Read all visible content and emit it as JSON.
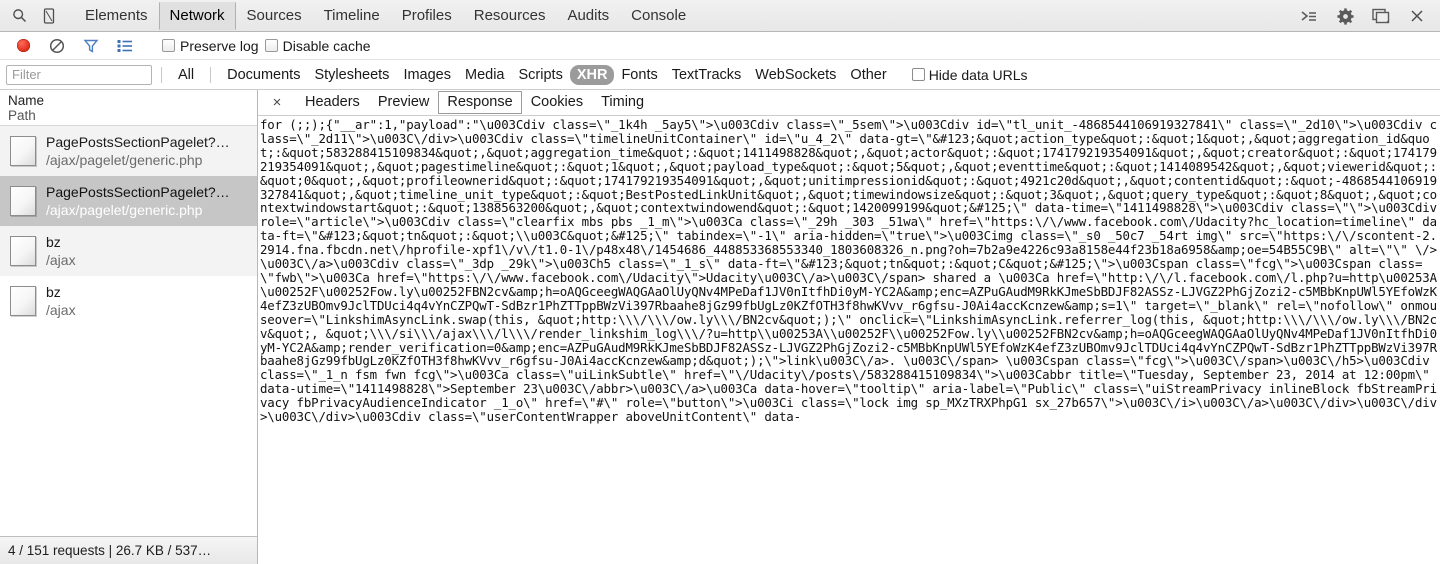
{
  "toolbar": {
    "icons": [
      {
        "name": "search-icon",
        "label": "Search"
      },
      {
        "name": "device-mode-icon",
        "label": "Toggle device mode"
      }
    ],
    "panels": [
      {
        "label": "Elements",
        "selected": false
      },
      {
        "label": "Network",
        "selected": true
      },
      {
        "label": "Sources",
        "selected": false
      },
      {
        "label": "Timeline",
        "selected": false
      },
      {
        "label": "Profiles",
        "selected": false
      },
      {
        "label": "Resources",
        "selected": false
      },
      {
        "label": "Audits",
        "selected": false
      },
      {
        "label": "Console",
        "selected": false
      }
    ],
    "right_icons": [
      {
        "name": "show-drawer-icon",
        "label": "Show console drawer"
      },
      {
        "name": "gear-icon",
        "label": "Settings"
      },
      {
        "name": "dock-side-icon",
        "label": "Dock side"
      },
      {
        "name": "close-icon",
        "label": "Close"
      }
    ]
  },
  "subbar": {
    "record_label": "Record",
    "clear_label": "Clear",
    "filter_label": "Filter",
    "group_label": "Group by frame",
    "preserve_log": {
      "label": "Preserve log",
      "checked": false
    },
    "disable_cache": {
      "label": "Disable cache",
      "checked": false
    }
  },
  "filterbar": {
    "filter_placeholder": "Filter",
    "filter_value": "",
    "types": [
      {
        "label": "All",
        "selected": false
      },
      {
        "label": "Documents",
        "selected": false
      },
      {
        "label": "Stylesheets",
        "selected": false
      },
      {
        "label": "Images",
        "selected": false
      },
      {
        "label": "Media",
        "selected": false
      },
      {
        "label": "Scripts",
        "selected": false
      },
      {
        "label": "XHR",
        "selected": true
      },
      {
        "label": "Fonts",
        "selected": false
      },
      {
        "label": "TextTracks",
        "selected": false
      },
      {
        "label": "WebSockets",
        "selected": false
      },
      {
        "label": "Other",
        "selected": false
      }
    ],
    "hide_data_urls": {
      "label": "Hide data URLs",
      "checked": false
    }
  },
  "requests": {
    "columns": {
      "name": "Name",
      "path": "Path"
    },
    "rows": [
      {
        "name": "PagePostsSectionPagelet?…",
        "path": "/ajax/pagelet/generic.php",
        "selected": false,
        "alt": true
      },
      {
        "name": "PagePostsSectionPagelet?…",
        "path": "/ajax/pagelet/generic.php",
        "selected": true,
        "alt": false
      },
      {
        "name": "bz",
        "path": "/ajax",
        "selected": false,
        "alt": true
      },
      {
        "name": "bz",
        "path": "/ajax",
        "selected": false,
        "alt": false
      }
    ]
  },
  "detail": {
    "close_label": "×",
    "tabs": [
      {
        "label": "Headers",
        "selected": false
      },
      {
        "label": "Preview",
        "selected": false
      },
      {
        "label": "Response",
        "selected": true
      },
      {
        "label": "Cookies",
        "selected": false
      },
      {
        "label": "Timing",
        "selected": false
      }
    ],
    "response_text": "for (;;);{\"__ar\":1,\"payload\":\"\\u003Cdiv class=\\\"_1k4h _5ay5\\\">\\u003Cdiv class=\\\"_5sem\\\">\\u003Cdiv id=\\\"tl_unit_-4868544106919327841\\\" class=\\\"_2d10\\\">\\u003Cdiv class=\\\"_2d11\\\">\\u003C\\/div>\\u003Cdiv class=\\\"timelineUnitContainer\\\" id=\\\"u_4_2\\\" data-gt=\\\"&#123;&quot;action_type&quot;:&quot;1&quot;,&quot;aggregation_id&quot;:&quot;583288415109834&quot;,&quot;aggregation_time&quot;:&quot;1411498828&quot;,&quot;actor&quot;:&quot;174179219354091&quot;,&quot;creator&quot;:&quot;174179219354091&quot;,&quot;pagestimeline&quot;:&quot;1&quot;,&quot;payload_type&quot;:&quot;5&quot;,&quot;eventtime&quot;:&quot;1414089542&quot;,&quot;viewerid&quot;:&quot;0&quot;,&quot;profileownerid&quot;:&quot;174179219354091&quot;,&quot;unitimpressionid&quot;:&quot;4921c20d&quot;,&quot;contentid&quot;:&quot;-4868544106919327841&quot;,&quot;timeline_unit_type&quot;:&quot;BestPostedLinkUnit&quot;,&quot;timewindowsize&quot;:&quot;3&quot;,&quot;query_type&quot;:&quot;8&quot;,&quot;contextwindowstart&quot;:&quot;1388563200&quot;,&quot;contextwindowend&quot;:&quot;1420099199&quot;&#125;\\\" data-time=\\\"1411498828\\\">\\u003Cdiv class=\\\"\\\">\\u003Cdiv role=\\\"article\\\">\\u003Cdiv class=\\\"clearfix mbs pbs _1_m\\\">\\u003Ca class=\\\"_29h _303 _51wa\\\" href=\\\"https:\\/\\/www.facebook.com\\/Udacity?hc_location=timeline\\\" data-ft=\\\"&#123;&quot;tn&quot;:&quot;\\\\u003C&quot;&#125;\\\" tabindex=\\\"-1\\\" aria-hidden=\\\"true\\\">\\u003Cimg class=\\\"_s0 _50c7 _54rt img\\\" src=\\\"https:\\/\\/scontent-2.2914.fna.fbcdn.net\\/hprofile-xpf1\\/v\\/t1.0-1\\/p48x48\\/1454686_448853368553340_1803608326_n.png?oh=7b2a9e4226c93a8158e44f23b18a6958&amp;oe=54B55C9B\\\" alt=\\\"\\\" \\/>\\u003C\\/a>\\u003Cdiv class=\\\"_3dp _29k\\\">\\u003Ch5 class=\\\"_1_s\\\" data-ft=\\\"&#123;&quot;tn&quot;:&quot;C&quot;&#125;\\\">\\u003Cspan class=\\\"fcg\\\">\\u003Cspan class=\\\"fwb\\\">\\u003Ca href=\\\"https:\\/\\/www.facebook.com\\/Udacity\\\">Udacity\\u003C\\/a>\\u003C\\/span> shared a \\u003Ca href=\\\"http:\\/\\/l.facebook.com\\/l.php?u=http\\u00253A\\u00252F\\u00252Fow.ly\\u00252FBN2cv&amp;h=oAQGceegWAQGAaOlUyQNv4MPeDaf1JV0nItfhDi0yM-YC2A&amp;enc=AZPuGAudM9RkKJmeSbBDJF82ASSz-LJVGZ2PhGjZozi2-c5MBbKnpUWl5YEfoWzK4efZ3zUBOmv9JclTDUci4q4vYnCZPQwT-SdBzr1PhZTTppBWzVi397Rbaahe8jGz99fbUgLz0KZfOTH3f8hwKVvv_r6gfsu-J0Ai4accKcnzew&amp;s=1\\\" target=\\\"_blank\\\" rel=\\\"nofollow\\\" onmouseover=\\\"LinkshimAsyncLink.swap(this, &quot;http:\\\\\\/\\\\\\/ow.ly\\\\\\/BN2cv&quot;);\\\" onclick=\\\"LinkshimAsyncLink.referrer_log(this, &quot;http:\\\\\\/\\\\\\/ow.ly\\\\\\/BN2cv&quot;, &quot;\\\\\\/si\\\\\\/ajax\\\\\\/l\\\\\\/render_linkshim_log\\\\\\/?u=http\\\\u00253A\\\\u00252F\\\\u00252Fow.ly\\\\u00252FBN2cv&amp;h=oAQGceegWAQGAaOlUyQNv4MPeDaf1JV0nItfhDi0yM-YC2A&amp;render_verification=0&amp;enc=AZPuGAudM9RkKJmeSbBDJF82ASSz-LJVGZ2PhGjZozi2-c5MBbKnpUWl5YEfoWzK4efZ3zUBOmv9JclTDUci4q4vYnCZPQwT-SdBzr1PhZTTppBWzVi397Rbaahe8jGz99fbUgLz0KZfOTH3f8hwKVvv_r6gfsu-J0Ai4accKcnzew&amp;d&quot;);\\\">link\\u003C\\/a>. \\u003C\\/span> \\u003Cspan class=\\\"fcg\\\">\\u003C\\/span>\\u003C\\/h5>\\u003Cdiv class=\\\"_1_n fsm fwn fcg\\\">\\u003Ca class=\\\"uiLinkSubtle\\\" href=\\\"\\/Udacity\\/posts\\/583288415109834\\\">\\u003Cabbr title=\\\"Tuesday, September 23, 2014 at 12:00pm\\\" data-utime=\\\"1411498828\\\">September 23\\u003C\\/abbr>\\u003C\\/a>\\u003Ca data-hover=\\\"tooltip\\\" aria-label=\\\"Public\\\" class=\\\"uiStreamPrivacy inlineBlock fbStreamPrivacy fbPrivacyAudienceIndicator _1_o\\\" href=\\\"#\\\" role=\\\"button\\\">\\u003Ci class=\\\"lock img sp_MXzTRXPhpG1 sx_27b657\\\">\\u003C\\/i>\\u003C\\/a>\\u003C\\/div>\\u003C\\/div>\\u003C\\/div>\\u003Cdiv class=\\\"userContentWrapper aboveUnitContent\\\" data-"
  },
  "statusbar": {
    "text": "4 / 151 requests | 26.7 KB / 537…"
  }
}
